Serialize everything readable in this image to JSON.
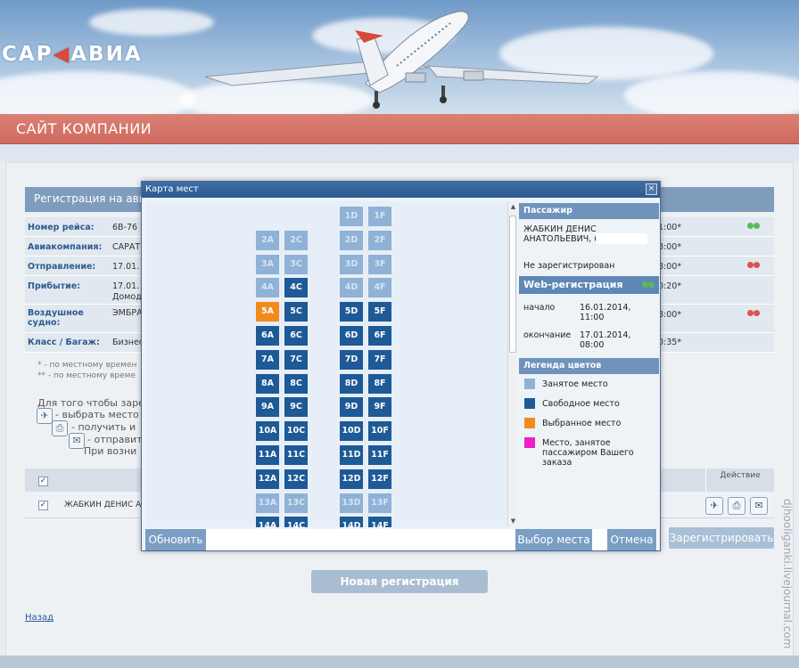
{
  "header": {
    "logo": "САР",
    "logo_tail": "АВИА",
    "banner_title": "САЙТ КОМПАНИИ"
  },
  "registration": {
    "title": "Регистрация на ави",
    "rows": [
      {
        "label": "Номер рейса:",
        "value": "6В-76",
        "right": "1:00*",
        "dots": "green"
      },
      {
        "label": "Авиакомпания:",
        "value": "САРАТ",
        "right": "8:00*",
        "dots": ""
      },
      {
        "label": "Отправление:",
        "value": "17.01.",
        "right": "8:00*",
        "dots": "red"
      },
      {
        "label": "Прибытие:",
        "value": "17.01.",
        "value2": "Домод",
        "right": "0:20*",
        "dots": ""
      },
      {
        "label": "Воздушное",
        "label2": "судно:",
        "value": "ЭМБРА",
        "right": "8:00*",
        "dots": "red"
      },
      {
        "label": "Класс / Багаж:",
        "value": "Бизнес",
        "right": "0:35*",
        "dots": ""
      }
    ],
    "notes": [
      "* - по местному времен",
      "** - по местному време"
    ],
    "instructions": [
      "Для того чтобы заре",
      "- выбрать место",
      "- получить и",
      "- отправит",
      "При возни"
    ]
  },
  "passenger_table": {
    "action_header": "Действие",
    "passenger_name": "ЖАБКИН ДЕНИС А"
  },
  "buttons": {
    "register": "Зарегистрировать",
    "new_registration": "Новая регистрация",
    "back": "Назад"
  },
  "watermark": "djhooliganki.livejournal.com",
  "modal": {
    "title": "Карта мест",
    "close": "×",
    "rows": [
      {
        "l": [
          "",
          ""
        ],
        "r": [
          "1D",
          "1F"
        ],
        "states": [
          "",
          "",
          "occ",
          "occ"
        ]
      },
      {
        "l": [
          "2A",
          "2C"
        ],
        "r": [
          "2D",
          "2F"
        ],
        "states": [
          "occ",
          "occ",
          "occ",
          "occ"
        ]
      },
      {
        "l": [
          "3A",
          "3C"
        ],
        "r": [
          "3D",
          "3F"
        ],
        "states": [
          "occ",
          "occ",
          "occ",
          "occ"
        ]
      },
      {
        "l": [
          "4A",
          "4C"
        ],
        "r": [
          "4D",
          "4F"
        ],
        "states": [
          "occ",
          "free",
          "occ",
          "occ"
        ]
      },
      {
        "l": [
          "5A",
          "5C"
        ],
        "r": [
          "5D",
          "5F"
        ],
        "states": [
          "sel",
          "free",
          "free",
          "free"
        ]
      },
      {
        "l": [
          "6A",
          "6C"
        ],
        "r": [
          "6D",
          "6F"
        ],
        "states": [
          "free",
          "free",
          "free",
          "free"
        ]
      },
      {
        "l": [
          "7A",
          "7C"
        ],
        "r": [
          "7D",
          "7F"
        ],
        "states": [
          "free",
          "free",
          "free",
          "free"
        ]
      },
      {
        "l": [
          "8A",
          "8C"
        ],
        "r": [
          "8D",
          "8F"
        ],
        "states": [
          "free",
          "free",
          "free",
          "free"
        ]
      },
      {
        "l": [
          "9A",
          "9C"
        ],
        "r": [
          "9D",
          "9F"
        ],
        "states": [
          "free",
          "free",
          "free",
          "free"
        ]
      },
      {
        "l": [
          "10A",
          "10C"
        ],
        "r": [
          "10D",
          "10F"
        ],
        "states": [
          "free",
          "free",
          "free",
          "free"
        ]
      },
      {
        "l": [
          "11A",
          "11C"
        ],
        "r": [
          "11D",
          "11F"
        ],
        "states": [
          "free",
          "free",
          "free",
          "free"
        ]
      },
      {
        "l": [
          "12A",
          "12C"
        ],
        "r": [
          "12D",
          "12F"
        ],
        "states": [
          "free",
          "free",
          "free",
          "free"
        ]
      },
      {
        "l": [
          "13A",
          "13C"
        ],
        "r": [
          "13D",
          "13F"
        ],
        "states": [
          "occ",
          "occ",
          "occ",
          "occ"
        ]
      },
      {
        "l": [
          "14A",
          "14C"
        ],
        "r": [
          "14D",
          "14F"
        ],
        "states": [
          "free",
          "free",
          "free",
          "free"
        ]
      }
    ],
    "side": {
      "passenger_head": "Пассажир",
      "passenger_name1": "ЖАБКИН ДЕНИС",
      "passenger_name2": "АНАТОЛЬЕВИЧ, (",
      "passenger_status": "Не зарегистрирован",
      "web_head": "Web-регистрация",
      "start_label": "начало",
      "start_date": "16.01.2014,",
      "start_time": "11:00",
      "end_label": "окончание",
      "end_date": "17.01.2014,",
      "end_time": "08:00",
      "legend_head": "Легенда цветов",
      "legend": [
        {
          "label": "Занятое место",
          "color": "#8fb2d6"
        },
        {
          "label": "Свободное место",
          "color": "#1e5a96"
        },
        {
          "label": "Выбранное место",
          "color": "#f28a1d"
        },
        {
          "label": "Место, занятое пассажиром Вашего заказа",
          "color": "#ee1fc8"
        }
      ]
    },
    "footer": {
      "refresh": "Обновить",
      "choose": "Выбор места",
      "cancel": "Отмена"
    }
  }
}
